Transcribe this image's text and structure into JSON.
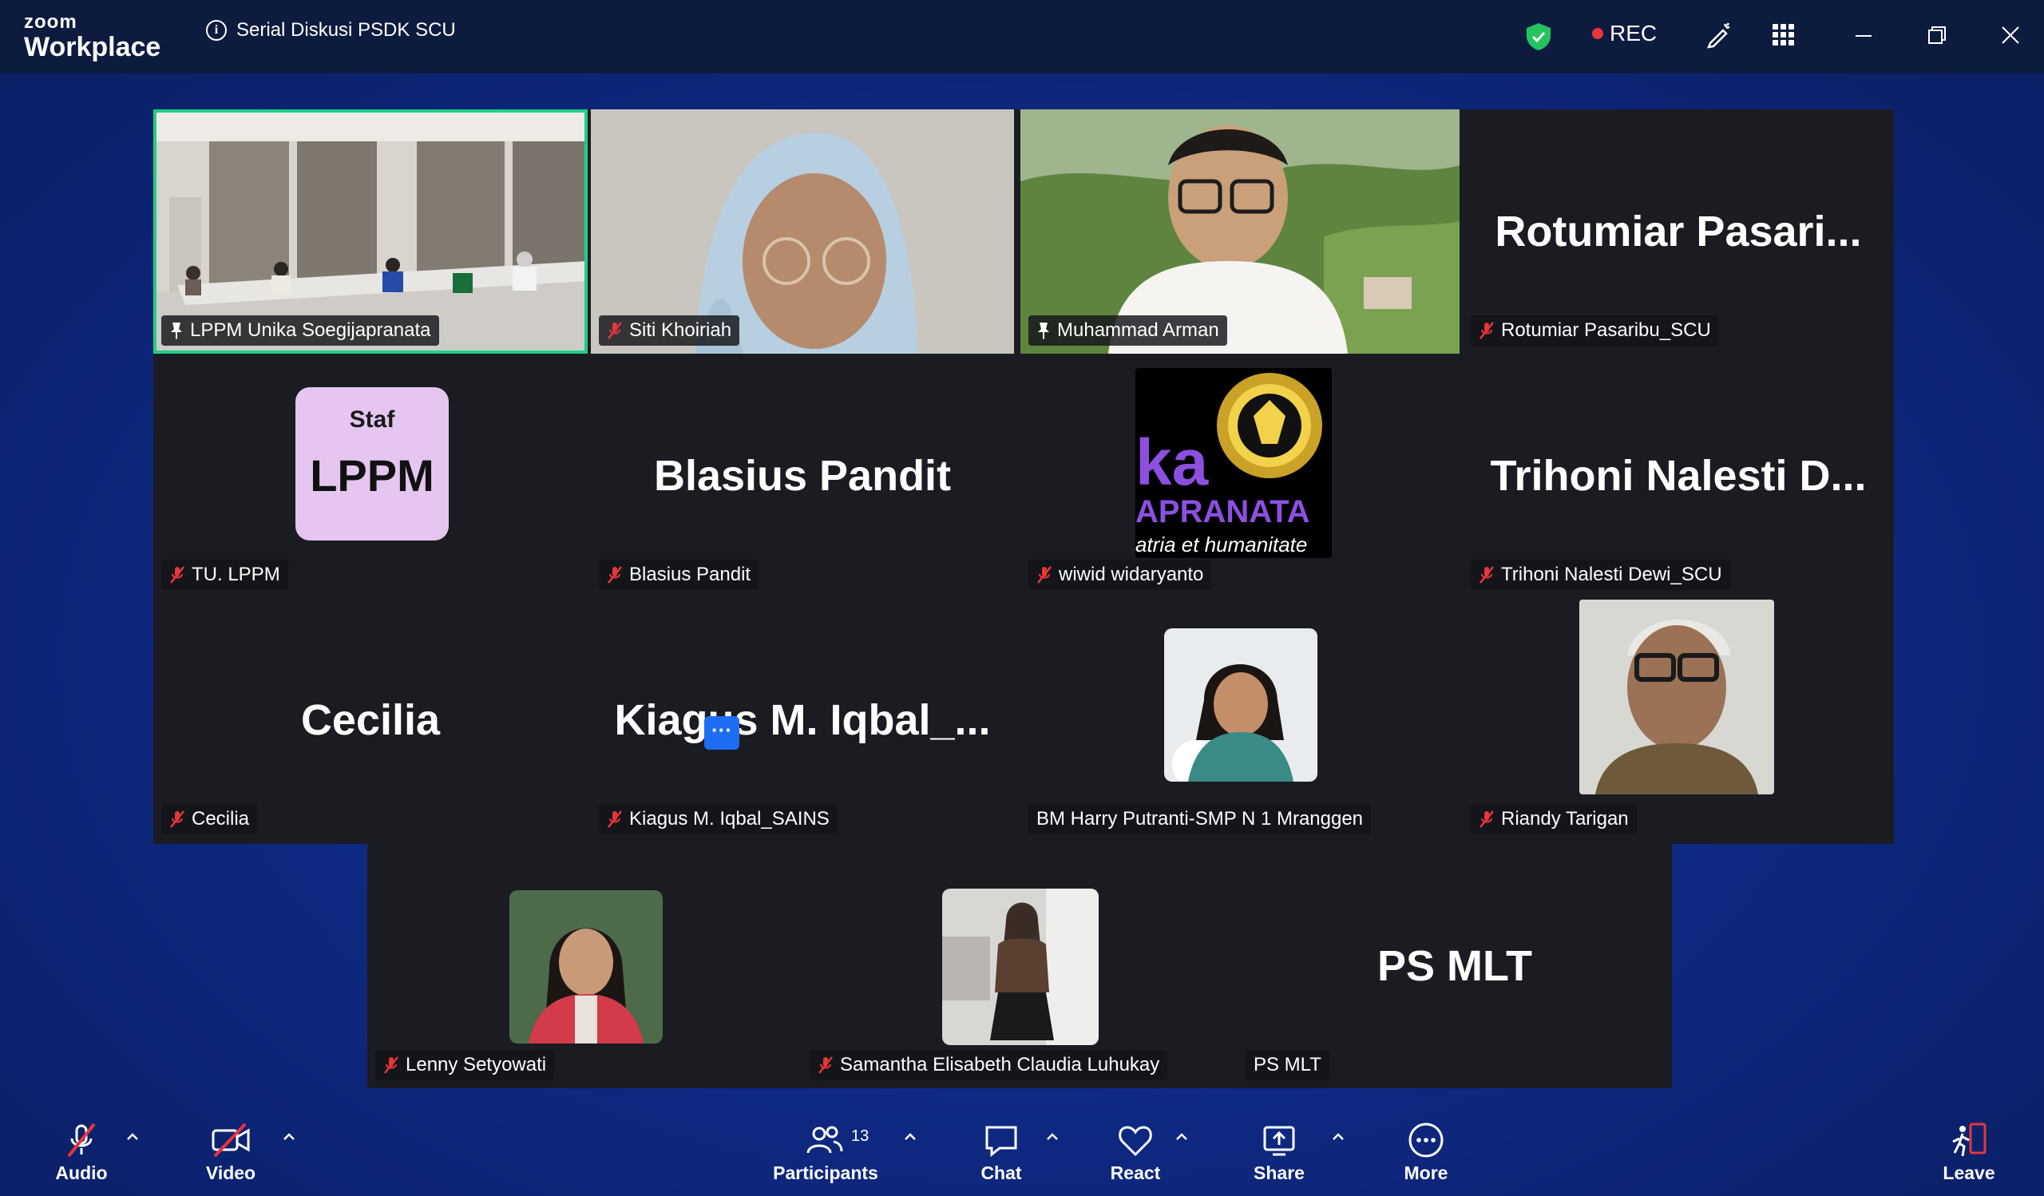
{
  "app": {
    "logo_top": "zoom",
    "logo_bottom": "Workplace",
    "meeting_title": "Serial Diskusi PSDK SCU",
    "rec_label": "REC"
  },
  "tiles": {
    "t1": {
      "name": "LPPM Unika Soegijapranata"
    },
    "t2": {
      "name": "Siti Khoiriah"
    },
    "t3": {
      "name": "Muhammad Arman"
    },
    "t4": {
      "big": "Rotumiar  Pasari...",
      "name": "Rotumiar Pasaribu_SCU"
    },
    "t5": {
      "avatar_top": "Staf",
      "avatar_bottom": "LPPM",
      "name": "TU. LPPM"
    },
    "t6": {
      "big": "Blasius Pandit",
      "name": "Blasius Pandit"
    },
    "t7": {
      "logo_big": "ka",
      "logo_mid": "APRANATA",
      "logo_low": "atria et humanitate",
      "name": "wiwid widaryanto"
    },
    "t8": {
      "big": "Trihoni  Nalesti  D...",
      "name": "Trihoni Nalesti Dewi_SCU"
    },
    "t9": {
      "big": "Cecilia",
      "name": "Cecilia"
    },
    "t10": {
      "big": "Kiagus  M.  Iqbal_...",
      "name": "Kiagus M. Iqbal_SAINS"
    },
    "t11": {
      "name": "BM  Harry Putranti-SMP N 1 Mranggen"
    },
    "t12": {
      "name": "Riandy Tarigan"
    },
    "t13": {
      "name": "Lenny Setyowati"
    },
    "t14": {
      "name": "Samantha Elisabeth Claudia Luhukay"
    },
    "t15": {
      "big": "PS MLT",
      "name": "PS MLT"
    }
  },
  "more_dots": "···",
  "toolbar": {
    "audio": "Audio",
    "video": "Video",
    "participants": "Participants",
    "participants_count": "13",
    "chat": "Chat",
    "react": "React",
    "share": "Share",
    "more": "More",
    "leave": "Leave"
  },
  "colors": {
    "active_border": "#1fcf86",
    "mute_red": "#e8363a",
    "accent_blue": "#1e6df5"
  }
}
